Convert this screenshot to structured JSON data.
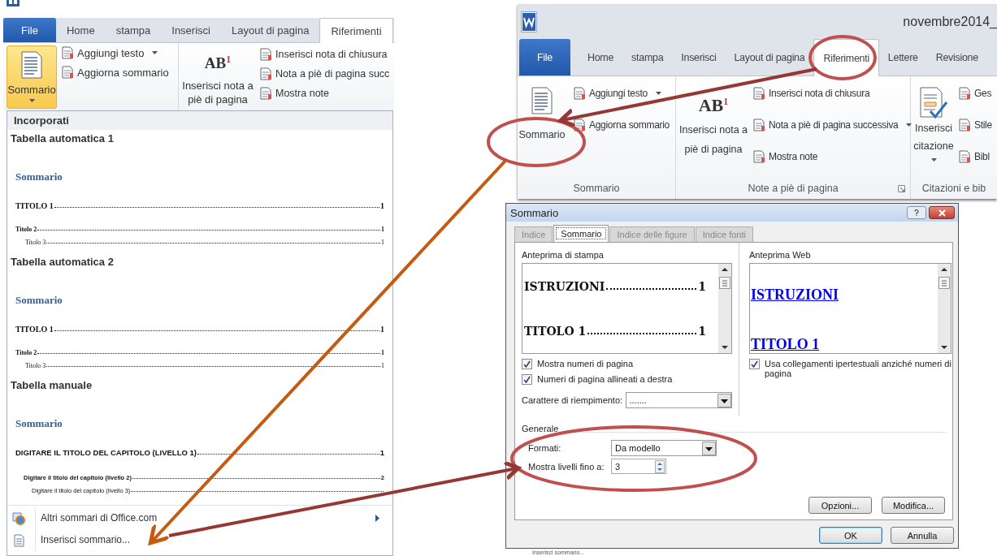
{
  "left_window": {
    "tabs": [
      {
        "label": "File",
        "kind": "file",
        "selected": false
      },
      {
        "label": "Home",
        "kind": "tab",
        "selected": false
      },
      {
        "label": "stampa",
        "kind": "tab",
        "selected": false
      },
      {
        "label": "Inserisci",
        "kind": "tab",
        "selected": false
      },
      {
        "label": "Layout di pagina",
        "kind": "tab",
        "selected": false
      },
      {
        "label": "Riferimenti",
        "kind": "tab",
        "selected": true
      }
    ],
    "groups": [
      {
        "kind": "toc",
        "big": {
          "label": "Sommario",
          "dropdown": true,
          "selected": true
        },
        "small": [
          {
            "label": "Aggiungi testo",
            "dropdown": true
          },
          {
            "label": "Aggiorna sommario",
            "dropdown": false
          }
        ]
      },
      {
        "kind": "notes",
        "big": {
          "label": "Inserisci nota a piè di pagina",
          "glyph": "AB$^{1}$",
          "dropdown": false,
          "selected": false
        },
        "small": [
          {
            "label": "Inserisci nota di chiusura",
            "dropdown": false
          },
          {
            "label": "Nota a piè di pagina succ",
            "dropdown": false
          },
          {
            "label": "Mostra note",
            "dropdown": false
          }
        ]
      }
    ],
    "menu": {
      "header": "Incorporati",
      "gallery": [
        {
          "title": "Tabella automatica 1",
          "kind": "auto",
          "heading": "Sommario",
          "entries": [
            {
              "text": "TITOLO 1",
              "page": "1",
              "children": [
                {
                  "text": "Titolo 2",
                  "page": "1",
                  "children": [
                    {
                      "text": "Titolo 3",
                      "page": "1"
                    }
                  ]
                }
              ]
            }
          ]
        },
        {
          "title": "Tabella automatica 2",
          "kind": "auto",
          "heading": "Sommario",
          "entries": [
            {
              "text": "TITOLO 1",
              "page": "1",
              "children": [
                {
                  "text": "Titolo 2",
                  "page": "1",
                  "children": [
                    {
                      "text": "Titolo 3",
                      "page": "1"
                    }
                  ]
                }
              ]
            }
          ]
        },
        {
          "title": "Tabella manuale",
          "kind": "manual",
          "heading": "Sommario",
          "entries": [
            {
              "text": "DIGITARE IL TITOLO DEL CAPITOLO (LIVELLO 1)",
              "page": "1",
              "children": [
                {
                  "text": "Digitare il titolo del capitolo (livello 2)",
                  "page": "2",
                  "children": [
                    {
                      "text": "Digitare il titolo del capitolo (livello 3)"
                    }
                  ]
                }
              ]
            }
          ]
        }
      ],
      "items": [
        {
          "label": "Altri sommari di Office.com",
          "kind": "online",
          "submenu": true
        },
        {
          "label": "Inserisci sommario...",
          "kind": "insert",
          "submenu": false
        }
      ]
    }
  },
  "right_window": {
    "title": "novembre2014_",
    "tabs": [
      {
        "label": "File",
        "kind": "file",
        "selected": false
      },
      {
        "label": "Home",
        "kind": "tab",
        "selected": false
      },
      {
        "label": "stampa",
        "kind": "tab",
        "selected": false
      },
      {
        "label": "Inserisci",
        "kind": "tab",
        "selected": false
      },
      {
        "label": "Layout di pagina",
        "kind": "tab",
        "selected": false
      },
      {
        "label": "Riferimenti",
        "kind": "tab",
        "selected": true
      },
      {
        "label": "Lettere",
        "kind": "tab",
        "selected": false
      },
      {
        "label": "Revisione",
        "kind": "tab",
        "selected": false
      }
    ],
    "groups": [
      {
        "kind": "toc",
        "label": "Sommario",
        "launcher": false,
        "big": {
          "label": "Sommario",
          "dropdown": false,
          "selected": false
        },
        "small": [
          {
            "label": "Aggiungi testo",
            "dropdown": true
          },
          {
            "label": "Aggiorna sommario",
            "dropdown": false
          }
        ]
      },
      {
        "kind": "notes",
        "label": "Note a piè di pagina",
        "launcher": true,
        "big": {
          "label": "Inserisci nota a piè di pagina",
          "glyph": "AB$^{1}$",
          "dropdown": false,
          "selected": false
        },
        "small": [
          {
            "label": "Inserisci nota di chiusura",
            "dropdown": false
          },
          {
            "label": "Nota a piè di pagina successiva",
            "dropdown": true
          },
          {
            "label": "Mostra note",
            "dropdown": false
          }
        ]
      },
      {
        "kind": "citations",
        "label": "Citazioni e bib",
        "launcher": false,
        "big": {
          "label": "Inserisci citazione",
          "dropdown": true,
          "selected": false
        },
        "small": [
          {
            "label": "Ges",
            "dropdown": false
          },
          {
            "label": "Stile",
            "dropdown": false
          },
          {
            "label": "Bibl",
            "dropdown": false
          }
        ]
      }
    ]
  },
  "dialog": {
    "title": "Sommario",
    "tabs": [
      {
        "label": "Indice",
        "selected": false
      },
      {
        "label": "Sommario",
        "selected": true
      },
      {
        "label": "Indice delle figure",
        "selected": false
      },
      {
        "label": "Indice fonti",
        "selected": false
      }
    ],
    "print_preview": {
      "label": "Anteprima di stampa",
      "entries": [
        {
          "text": "ISTRUZIONI",
          "page": "1"
        },
        {
          "text": "TITOLO 1",
          "page": "1"
        }
      ]
    },
    "print_options": [
      {
        "label": "Mostra numeri di pagina",
        "checked": true
      },
      {
        "label": "Numeri di pagina allineati a destra",
        "checked": true
      }
    ],
    "fill_character": {
      "label": "Carattere di riempimento:",
      "value": "......."
    },
    "web_preview": {
      "label": "Anteprima Web",
      "entries": [
        "ISTRUZIONI",
        "TITOLO 1"
      ]
    },
    "web_options": [
      {
        "label": "Usa collegamenti ipertestuali anziché numeri di pagina",
        "checked": true
      }
    ],
    "general": {
      "label": "Generale",
      "formats": {
        "label": "Formati:",
        "value": "Da modello"
      },
      "levels": {
        "label": "Mostra livelli fino a:",
        "value": "3"
      }
    },
    "buttons": [
      "Opzioni...",
      "Modifica..."
    ],
    "footer_buttons": [
      {
        "label": "OK",
        "default": true
      },
      {
        "label": "Annulla",
        "default": false
      }
    ]
  },
  "background_fragment": {
    "text": "Inserisci sommario..."
  }
}
